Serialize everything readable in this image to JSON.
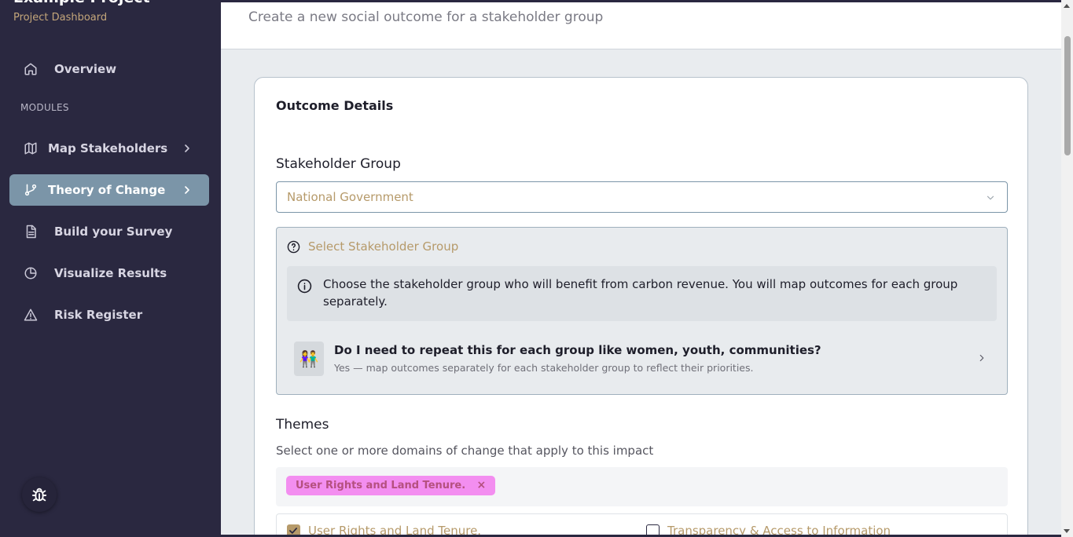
{
  "sidebar": {
    "project_title": "Example Project",
    "project_subtitle": "Project Dashboard",
    "modules_label": "MODULES",
    "items": [
      {
        "label": "Overview",
        "icon": "home-icon"
      },
      {
        "label": "Map Stakeholders",
        "icon": "map-icon"
      },
      {
        "label": "Theory of Change",
        "icon": "git-branch-icon"
      },
      {
        "label": "Build your Survey",
        "icon": "document-icon"
      },
      {
        "label": "Visualize Results",
        "icon": "pie-chart-icon"
      },
      {
        "label": "Risk Register",
        "icon": "warning-icon"
      }
    ],
    "active_item": "Theory of Change",
    "bug_icon": "bug-icon"
  },
  "header": {
    "subtitle": "Create a new social outcome for a stakeholder group"
  },
  "card": {
    "title": "Outcome Details",
    "stakeholder_label": "Stakeholder Group",
    "stakeholder_value": "National Government",
    "help": {
      "title": "Select Stakeholder Group",
      "info": "Choose the stakeholder group who will benefit from carbon revenue. You will map outcomes for each group separately.",
      "faq_question": "Do I need to repeat this for each group like women, youth, communities?",
      "faq_answer": "Yes — map outcomes separately for each stakeholder group to reflect their priorities.",
      "faq_emoji": "👫"
    },
    "themes_label": "Themes",
    "themes_desc": "Select one or more domains of change that apply to this impact",
    "selected_chip": "User Rights and Land Tenure.",
    "chip_remove": "×",
    "options": [
      {
        "label": "User Rights and Land Tenure.",
        "checked": true
      },
      {
        "label": "Transparency & Access to Information",
        "checked": false
      }
    ]
  },
  "colors": {
    "sidebar_bg": "#2a2840",
    "active_bg": "#7b95a8",
    "accent_gold": "#b69a6a",
    "chip_pink": "#f38ef0"
  }
}
